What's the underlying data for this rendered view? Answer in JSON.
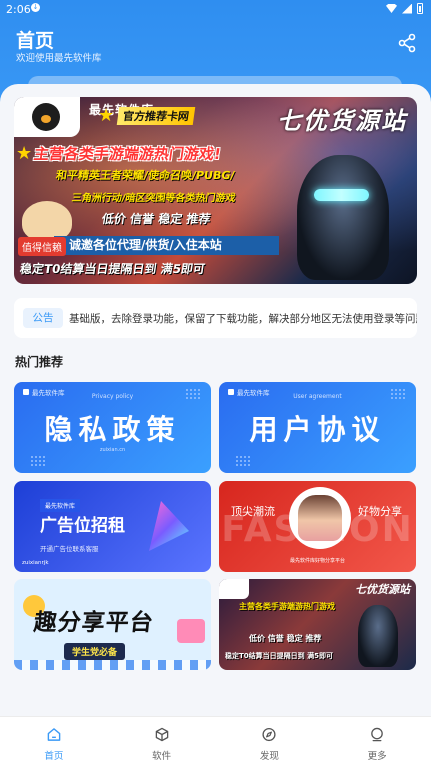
{
  "status_bar": {
    "time": "2:06"
  },
  "header": {
    "title": "首页",
    "subtitle": "欢迎使用最先软件库"
  },
  "banner": {
    "brand": "最先软件库",
    "official": "官方推荐卡网",
    "store": "七优货源站",
    "headline": "主营各类手游端游热门游戏!",
    "games1": "和平精英王者荣耀/使命召唤/PUBG/",
    "games2": "三角洲行动/暗区突围等各类热门游戏",
    "slogan": "低价 信誉 稳定 推荐",
    "recruit": "诚邀各位代理/供货/入住本站",
    "trust": "值得信赖",
    "settle": "稳定T0结算当日提隔日到 满5即可"
  },
  "notice": {
    "badge": "公告",
    "text": "基础版，去除登录功能，保留了下载功能，解决部分地区无法使用登录等问题"
  },
  "section": {
    "hot": "热门推荐"
  },
  "tiles": {
    "privacy": {
      "brand": "最先软件库",
      "sub": "Privacy policy",
      "big": "隐私政策",
      "small": "zuixian.cn"
    },
    "agreement": {
      "brand": "最先软件库",
      "sub": "User agreement",
      "big": "用户协议"
    },
    "ad": {
      "tag": "最先软件库",
      "title": "广告位招租",
      "sub": "开通广告位联系客服",
      "brand": "zuixianrjk"
    },
    "fashion": {
      "bg": "FASHION",
      "left": "顶尖潮流",
      "right": "好物分享",
      "caption": "最先软件库好物分享平台"
    },
    "share": {
      "title": "趣分享平台",
      "sub": "学生党必备"
    },
    "promo": {
      "line1": "主营各类手游端游热门游戏",
      "line2": "低价 信誉 稳定 推荐",
      "line3": "稳定T0结算当日提隔日到 满5即可",
      "store": "七优货源站"
    }
  },
  "tabbar": [
    {
      "label": "首页",
      "icon": "home-icon",
      "active": true
    },
    {
      "label": "软件",
      "icon": "cube-icon",
      "active": false
    },
    {
      "label": "发现",
      "icon": "compass-icon",
      "active": false
    },
    {
      "label": "更多",
      "icon": "user-circle-icon",
      "active": false
    }
  ],
  "colors": {
    "primary": "#3b9af6",
    "background": "#f4f6fa"
  }
}
